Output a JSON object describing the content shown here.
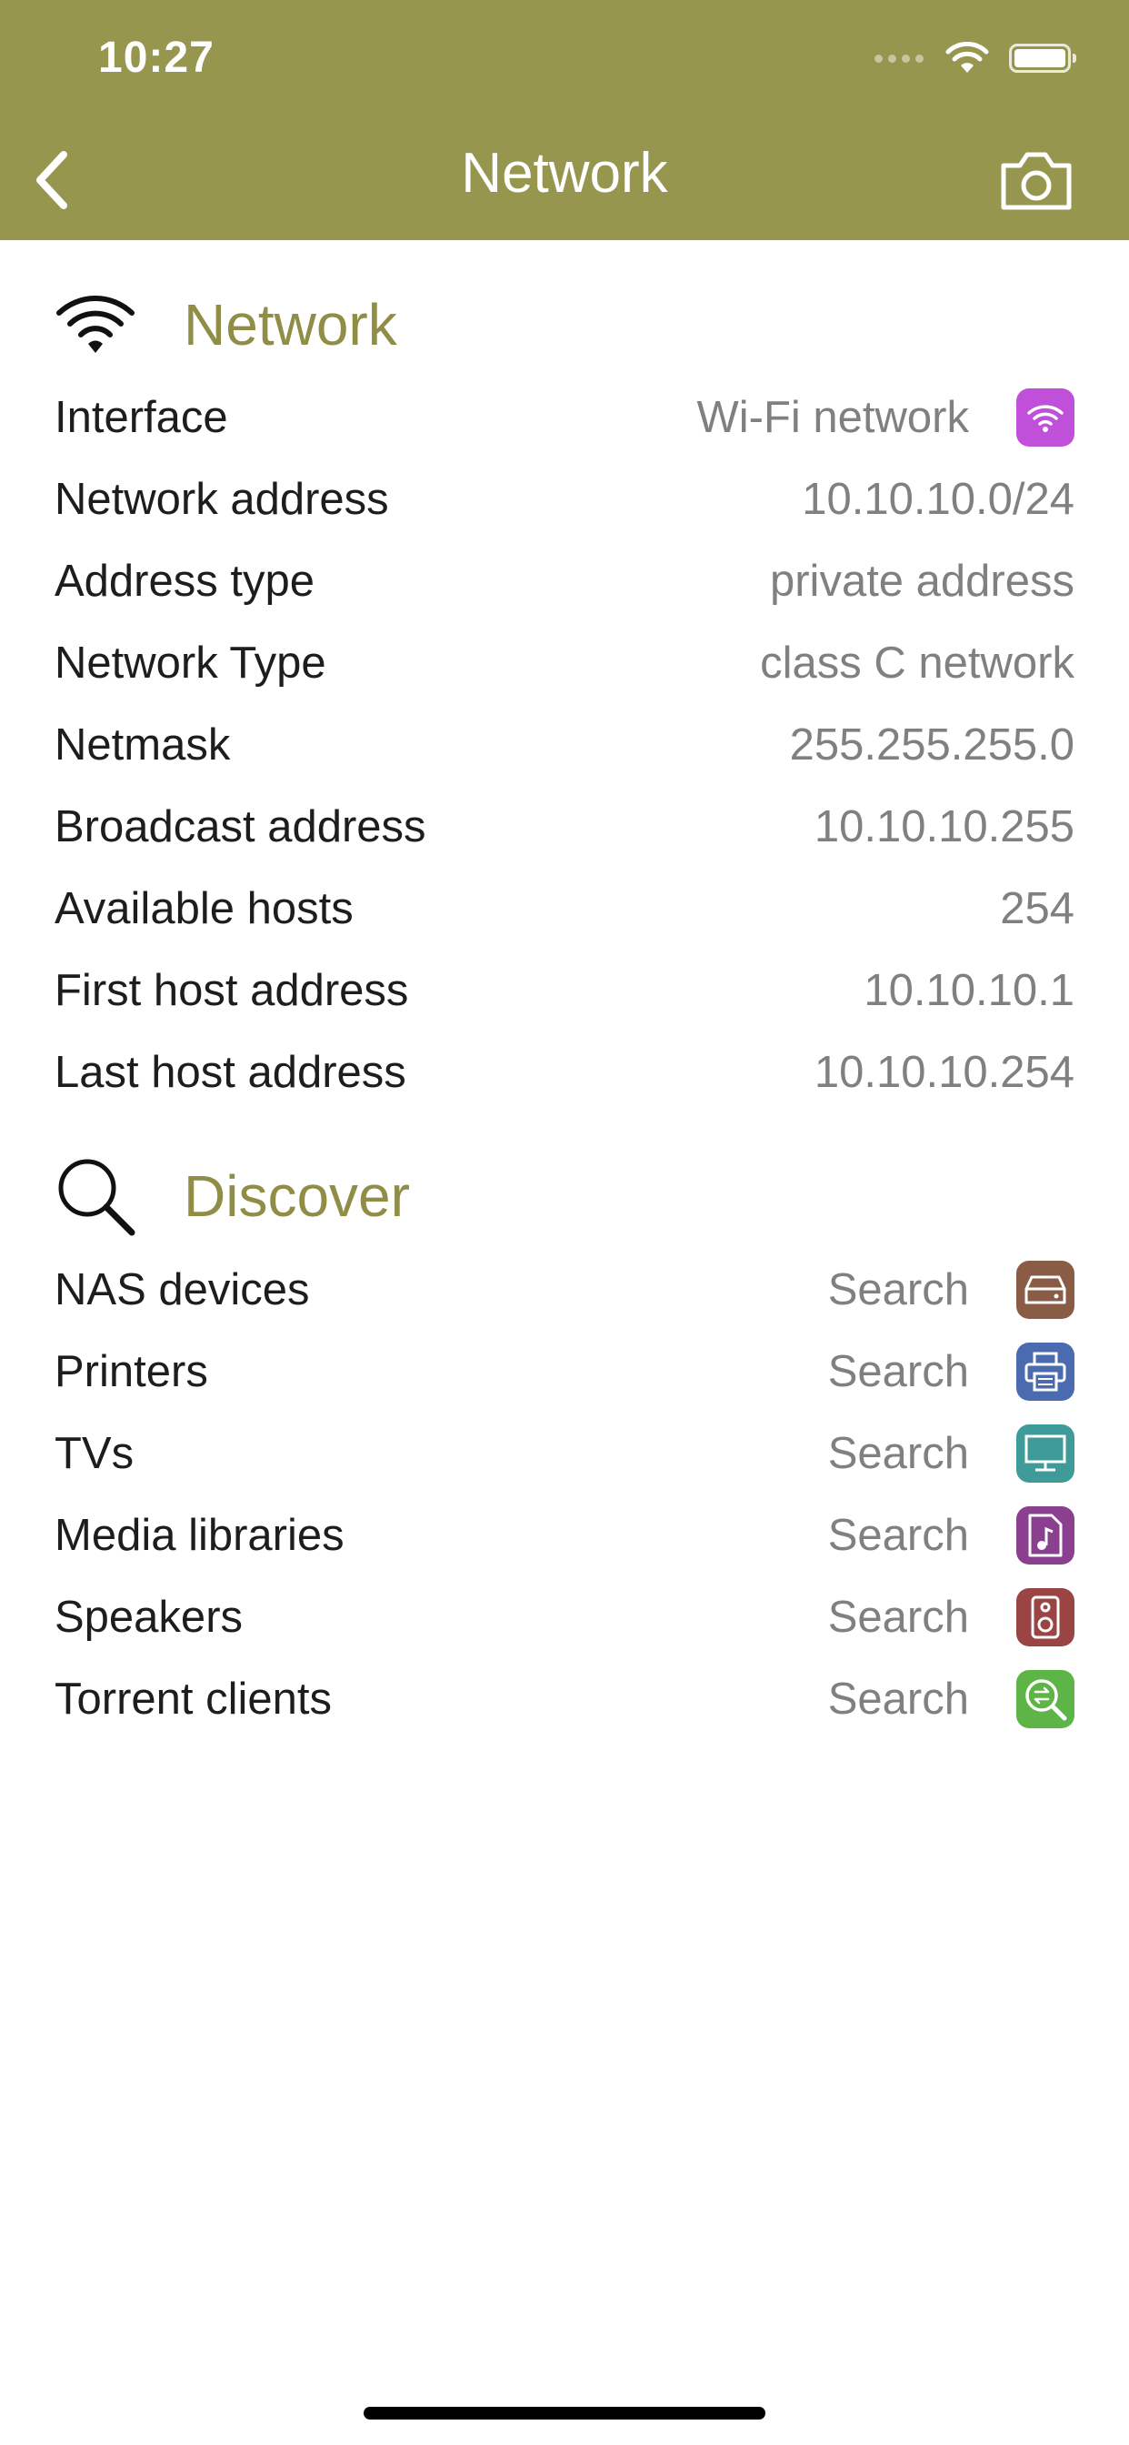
{
  "status_bar": {
    "time": "10:27"
  },
  "nav": {
    "title": "Network"
  },
  "network": {
    "title": "Network",
    "rows": [
      {
        "label": "Interface",
        "value": "Wi-Fi network",
        "icon": "wifi-icon",
        "icon_color": "#c04fd9"
      },
      {
        "label": "Network address",
        "value": "10.10.10.0/24"
      },
      {
        "label": "Address type",
        "value": "private address"
      },
      {
        "label": "Network Type",
        "value": "class C network"
      },
      {
        "label": "Netmask",
        "value": "255.255.255.0"
      },
      {
        "label": "Broadcast address",
        "value": "10.10.10.255"
      },
      {
        "label": "Available hosts",
        "value": "254"
      },
      {
        "label": "First host address",
        "value": "10.10.10.1"
      },
      {
        "label": "Last host address",
        "value": "10.10.10.254"
      }
    ]
  },
  "discover": {
    "title": "Discover",
    "rows": [
      {
        "label": "NAS devices",
        "value": "Search",
        "icon": "nas-drive-icon",
        "icon_color": "#8a5c45"
      },
      {
        "label": "Printers",
        "value": "Search",
        "icon": "printer-icon",
        "icon_color": "#4a6bb0"
      },
      {
        "label": "TVs",
        "value": "Search",
        "icon": "monitor-icon",
        "icon_color": "#3f9a9a"
      },
      {
        "label": "Media libraries",
        "value": "Search",
        "icon": "music-file-icon",
        "icon_color": "#8a3f8f"
      },
      {
        "label": "Speakers",
        "value": "Search",
        "icon": "speaker-icon",
        "icon_color": "#9a4443"
      },
      {
        "label": "Torrent clients",
        "value": "Search",
        "icon": "torrent-search-icon",
        "icon_color": "#5db547"
      }
    ]
  },
  "colors": {
    "header": "#97964e",
    "section_title": "#8f8d46"
  }
}
